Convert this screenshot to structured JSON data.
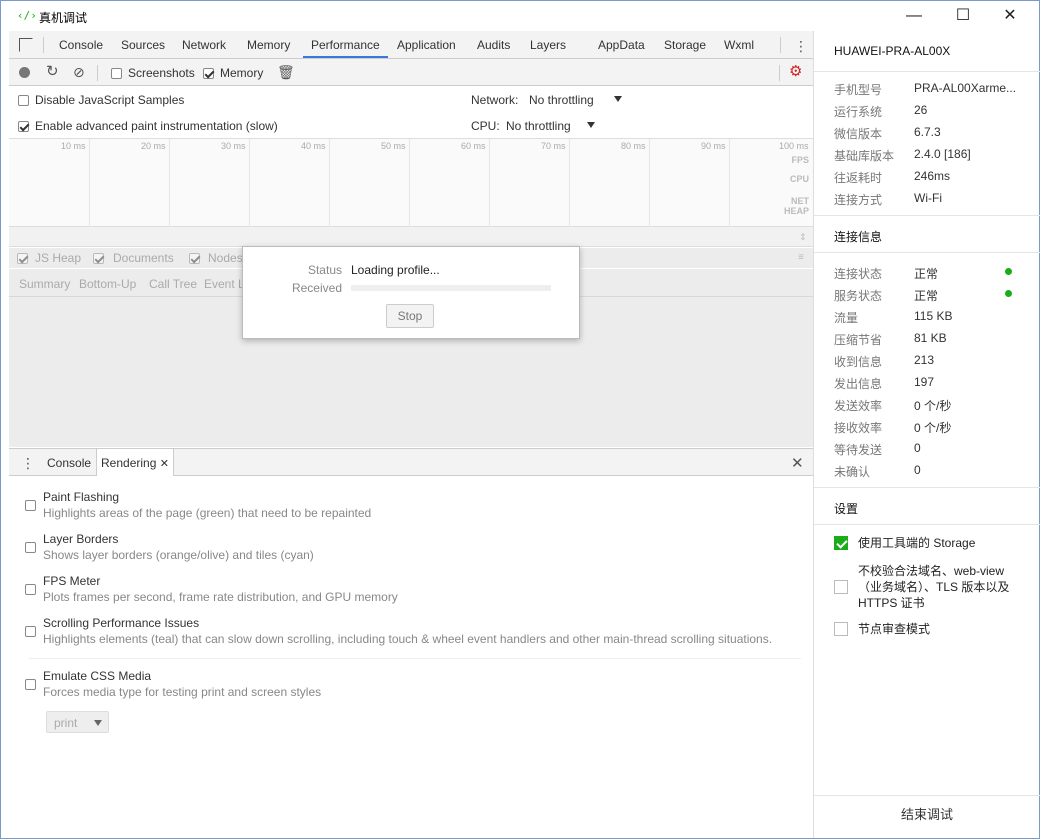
{
  "window": {
    "title": "真机调试",
    "icon": "code-icon"
  },
  "tabs": [
    "Console",
    "Sources",
    "Network",
    "Memory",
    "Performance",
    "Application",
    "Audits",
    "Layers",
    "AppData",
    "Storage",
    "Wxml"
  ],
  "active_tab": "Performance",
  "toolbar": {
    "screenshots": "Screenshots",
    "memory": "Memory"
  },
  "settings": {
    "disable_js_samples": "Disable JavaScript Samples",
    "advanced_paint": "Enable advanced paint instrumentation (slow)",
    "network_label": "Network:",
    "network_value": "No throttling",
    "cpu_label": "CPU:",
    "cpu_value": "No throttling"
  },
  "overview": {
    "ticks": [
      "10 ms",
      "20 ms",
      "30 ms",
      "40 ms",
      "50 ms",
      "60 ms",
      "70 ms",
      "80 ms",
      "90 ms",
      "100 ms"
    ],
    "rows": [
      "FPS",
      "CPU",
      "NET",
      "HEAP"
    ]
  },
  "counters": [
    "JS Heap",
    "Documents",
    "Nodes"
  ],
  "subtabs": [
    "Summary",
    "Bottom-Up",
    "Call Tree",
    "Event L"
  ],
  "dialog": {
    "status_label": "Status",
    "status_value": "Loading profile...",
    "received_label": "Received",
    "stop": "Stop"
  },
  "drawer": {
    "tabs": [
      "Console",
      "Rendering"
    ],
    "active": "Rendering"
  },
  "rendering": [
    {
      "title": "Paint Flashing",
      "desc": "Highlights areas of the page (green) that need to be repainted"
    },
    {
      "title": "Layer Borders",
      "desc": "Shows layer borders (orange/olive) and tiles (cyan)"
    },
    {
      "title": "FPS Meter",
      "desc": "Plots frames per second, frame rate distribution, and GPU memory"
    },
    {
      "title": "Scrolling Performance Issues",
      "desc": "Highlights elements (teal) that can slow down scrolling, including touch & wheel event handlers and other main-thread scrolling situations."
    },
    {
      "title": "Emulate CSS Media",
      "desc": "Forces media type for testing print and screen styles"
    }
  ],
  "media_select": "print",
  "panel": {
    "device": "HUAWEI-PRA-AL00X",
    "info": [
      {
        "k": "手机型号",
        "v": "PRA-AL00Xarme..."
      },
      {
        "k": "运行系统",
        "v": "26"
      },
      {
        "k": "微信版本",
        "v": "6.7.3"
      },
      {
        "k": "基础库版本",
        "v": "2.4.0 [186]"
      },
      {
        "k": "往返耗时",
        "v": "246ms"
      },
      {
        "k": "连接方式",
        "v": "Wi-Fi"
      }
    ],
    "conn_title": "连接信息",
    "conn": [
      {
        "k": "连接状态",
        "v": "正常"
      },
      {
        "k": "服务状态",
        "v": "正常"
      },
      {
        "k": "流量",
        "v": "115 KB"
      },
      {
        "k": "压缩节省",
        "v": "81 KB"
      },
      {
        "k": "收到信息",
        "v": "213"
      },
      {
        "k": "发出信息",
        "v": "197"
      },
      {
        "k": "发送效率",
        "v": "0 个/秒"
      },
      {
        "k": "接收效率",
        "v": "0 个/秒"
      },
      {
        "k": "等待发送",
        "v": "0"
      },
      {
        "k": "未确认",
        "v": "0"
      }
    ],
    "settings_title": "设置",
    "opt_storage": "使用工具端的 Storage",
    "opt_domain": "不校验合法域名、web-view（业务域名）、TLS 版本以及 HTTPS 证书",
    "opt_audit": "节点审查模式",
    "end": "结束调试",
    "status_color": "#1aad19"
  }
}
